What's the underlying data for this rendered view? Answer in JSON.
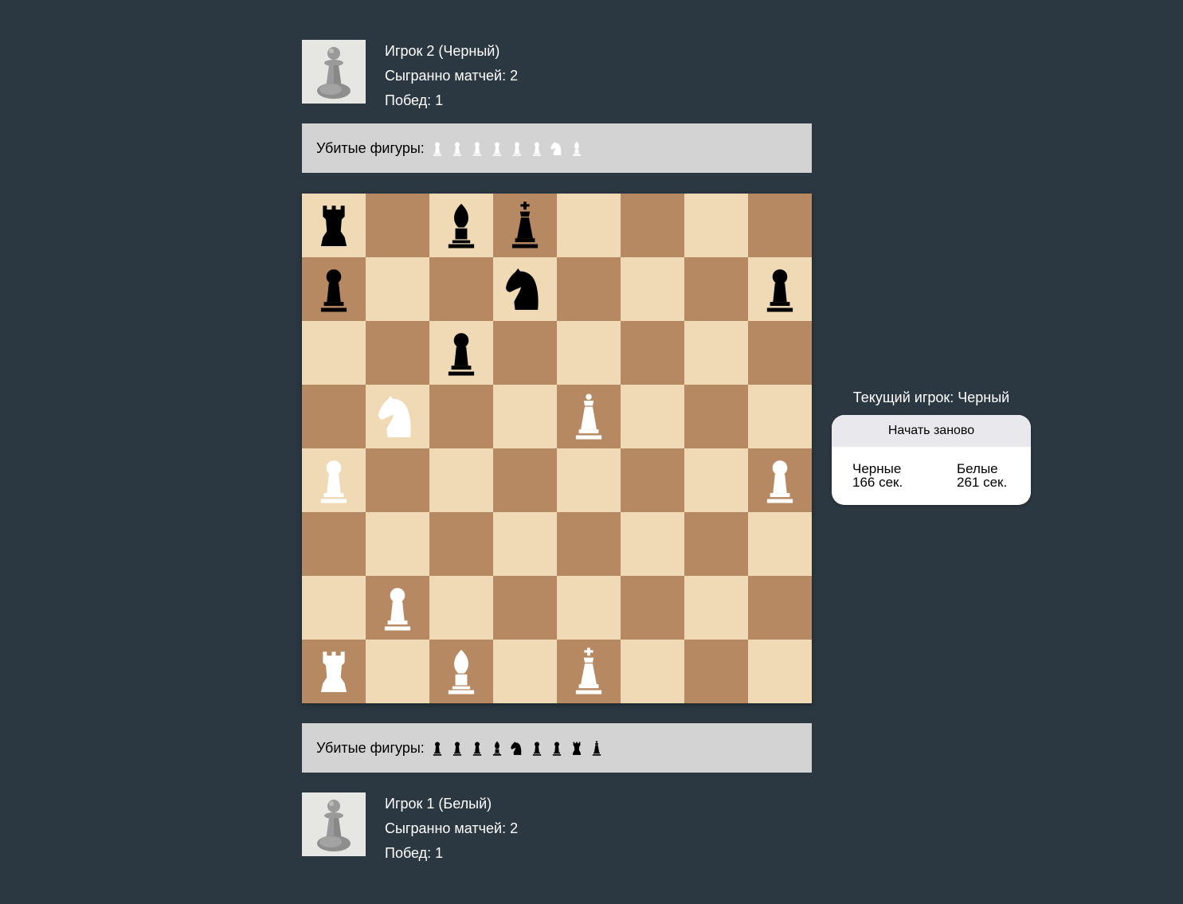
{
  "players": {
    "top": {
      "name": "Игрок 2 (Черный)",
      "matches": "Сыгранно матчей: 2",
      "wins": "Побед: 1",
      "avatar_icon": "pawn-avatar-icon"
    },
    "bottom": {
      "name": "Игрок 1 (Белый)",
      "matches": "Сыгранно матчей: 2",
      "wins": "Побед: 1",
      "avatar_icon": "pawn-avatar-icon"
    }
  },
  "captured": {
    "top": {
      "label": "Убитые фигуры:",
      "color": "white",
      "pieces": [
        "pawn",
        "pawn",
        "pawn",
        "pawn",
        "pawn",
        "pawn",
        "knight",
        "bishop"
      ]
    },
    "bottom": {
      "label": "Убитые фигуры:",
      "color": "black",
      "pieces": [
        "pawn",
        "pawn",
        "pawn",
        "bishop",
        "knight",
        "pawn",
        "pawn",
        "rook",
        "queen"
      ]
    }
  },
  "board": {
    "light_color": "#f0dab5",
    "dark_color": "#b78963",
    "rows": [
      [
        "bR",
        "",
        "bB",
        "bK",
        "",
        "",
        "",
        ""
      ],
      [
        "bP",
        "",
        "",
        "bN",
        "",
        "",
        "",
        "bP"
      ],
      [
        "",
        "",
        "bP",
        "",
        "",
        "",
        "",
        ""
      ],
      [
        "",
        "wN",
        "",
        "",
        "wQ",
        "",
        "",
        ""
      ],
      [
        "wP",
        "",
        "",
        "",
        "",
        "",
        "",
        "wP"
      ],
      [
        "",
        "",
        "",
        "",
        "",
        "",
        "",
        ""
      ],
      [
        "",
        "wP",
        "",
        "",
        "",
        "",
        "",
        ""
      ],
      [
        "wR",
        "",
        "wB",
        "",
        "wK",
        "",
        "",
        ""
      ]
    ]
  },
  "status": {
    "current_player": "Текущий игрок: Черный"
  },
  "controls": {
    "restart_label": "Начать заново"
  },
  "timers": {
    "black": {
      "label": "Черные",
      "value": "166 сек."
    },
    "white": {
      "label": "Белые",
      "value": "261 сек."
    }
  },
  "colors": {
    "background": "#2c3841",
    "captured_bar": "#d3d3d3",
    "white_piece": "#ffffff",
    "black_piece": "#000000"
  }
}
